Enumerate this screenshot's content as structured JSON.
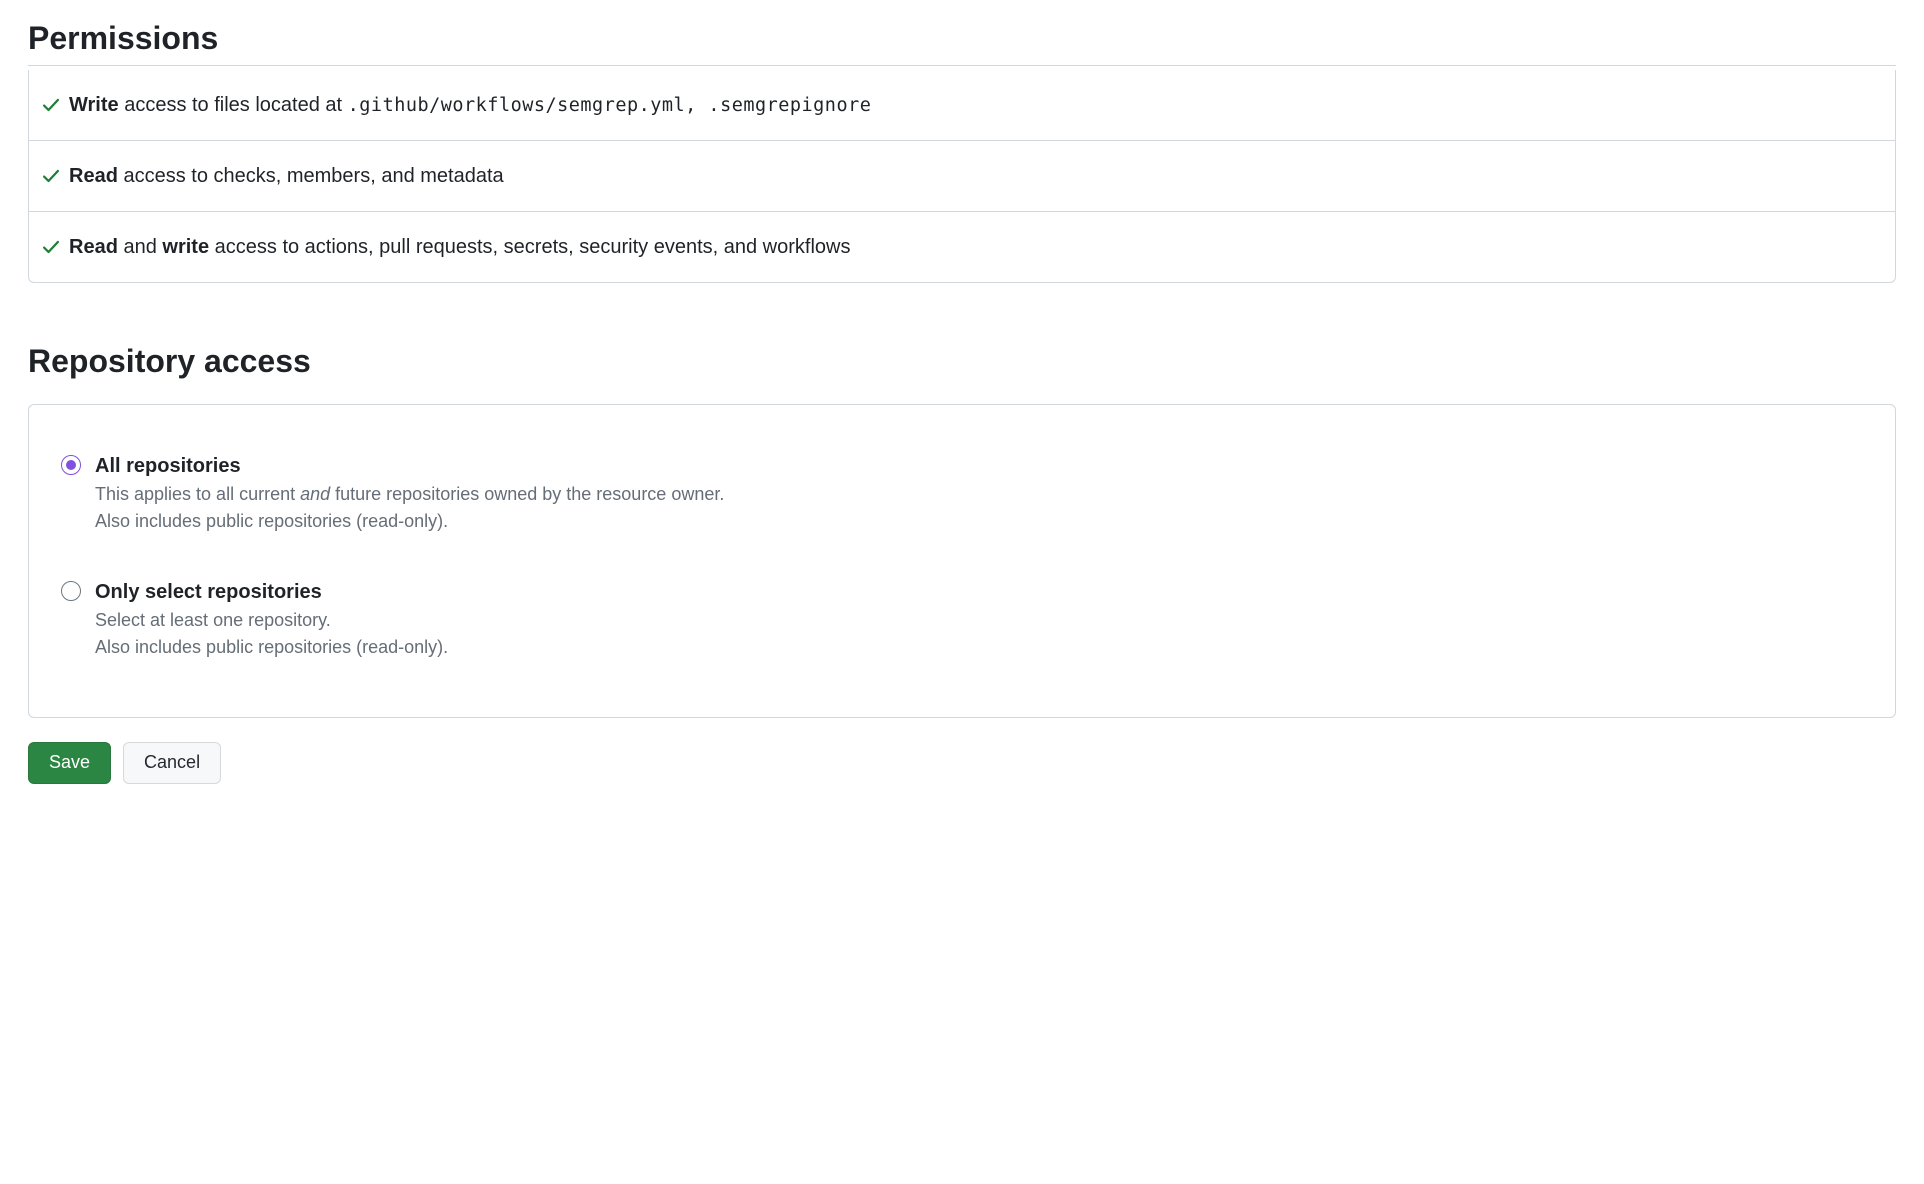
{
  "permissions": {
    "heading": "Permissions",
    "rows": [
      {
        "access_label": "Write",
        "text_middle": " access to files located at ",
        "paths": ".github/workflows/semgrep.yml, .semgrepignore"
      },
      {
        "access_label": "Read",
        "text_rest": " access to checks, members, and metadata"
      },
      {
        "access_label": "Read",
        "text_connector": " and ",
        "access_label2": "write",
        "text_rest": " access to actions, pull requests, secrets, security events, and workflows"
      }
    ]
  },
  "repo_access": {
    "heading": "Repository access",
    "options": [
      {
        "title": "All repositories",
        "desc_a": "This applies to all current ",
        "desc_italic": "and",
        "desc_b": " future repositories owned by the resource owner.",
        "desc_line2": "Also includes public repositories (read-only).",
        "selected": true
      },
      {
        "title": "Only select repositories",
        "desc_line1": "Select at least one repository.",
        "desc_line2": "Also includes public repositories (read-only).",
        "selected": false
      }
    ]
  },
  "actions": {
    "save": "Save",
    "cancel": "Cancel"
  },
  "colors": {
    "check": "#1a7f37",
    "radio_accent": "#8250df",
    "primary_btn": "#2c8643"
  }
}
